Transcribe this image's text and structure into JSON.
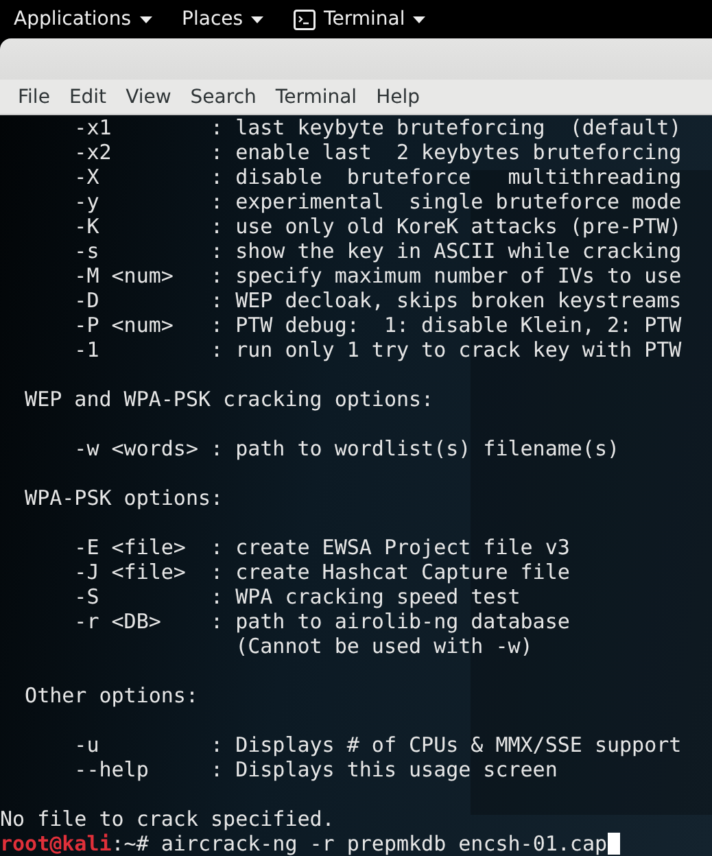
{
  "top_bar": {
    "menus": [
      {
        "kind": "menu",
        "label": "Applications"
      },
      {
        "kind": "menu",
        "label": "Places"
      },
      {
        "kind": "app",
        "label": "Terminal"
      }
    ]
  },
  "menu_bar": [
    "File",
    "Edit",
    "View",
    "Search",
    "Terminal",
    "Help"
  ],
  "terminal": {
    "lines": [
      {
        "kind": "option",
        "text": "-x1        : last keybyte bruteforcing  (default)"
      },
      {
        "kind": "option",
        "text": "-x2        : enable last  2 keybytes bruteforcing"
      },
      {
        "kind": "option",
        "text": "-X         : disable  bruteforce   multithreading"
      },
      {
        "kind": "option",
        "text": "-y         : experimental  single bruteforce mode"
      },
      {
        "kind": "option",
        "text": "-K         : use only old KoreK attacks (pre-PTW)"
      },
      {
        "kind": "option",
        "text": "-s         : show the key in ASCII while cracking"
      },
      {
        "kind": "option",
        "text": "-M <num>   : specify maximum number of IVs to use"
      },
      {
        "kind": "option",
        "text": "-D         : WEP decloak, skips broken keystreams"
      },
      {
        "kind": "option",
        "text": "-P <num>   : PTW debug:  1: disable Klein, 2: PTW"
      },
      {
        "kind": "option",
        "text": "-1         : run only 1 try to crack key with PTW"
      },
      {
        "kind": "blank"
      },
      {
        "kind": "heading",
        "text": "WEP and WPA-PSK cracking options:"
      },
      {
        "kind": "blank"
      },
      {
        "kind": "option",
        "text": "-w <words> : path to wordlist(s) filename(s)"
      },
      {
        "kind": "blank"
      },
      {
        "kind": "heading",
        "text": "WPA-PSK options:"
      },
      {
        "kind": "blank"
      },
      {
        "kind": "option",
        "text": "-E <file>  : create EWSA Project file v3"
      },
      {
        "kind": "option",
        "text": "-J <file>  : create Hashcat Capture file"
      },
      {
        "kind": "option",
        "text": "-S         : WPA cracking speed test"
      },
      {
        "kind": "option",
        "text": "-r <DB>    : path to airolib-ng database"
      },
      {
        "kind": "continuation",
        "text": "(Cannot be used with -w)"
      },
      {
        "kind": "blank"
      },
      {
        "kind": "heading",
        "text": "Other options:"
      },
      {
        "kind": "blank"
      },
      {
        "kind": "option",
        "text": "-u         : Displays # of CPUs & MMX/SSE support"
      },
      {
        "kind": "option",
        "text": "--help     : Displays this usage screen"
      },
      {
        "kind": "blank"
      },
      {
        "kind": "output",
        "text": "No file to crack specified."
      },
      {
        "kind": "prompt",
        "user": "root@kali",
        "text": ":~# aircrack-ng -r prepmkdb encsh-01.cap"
      }
    ]
  }
}
